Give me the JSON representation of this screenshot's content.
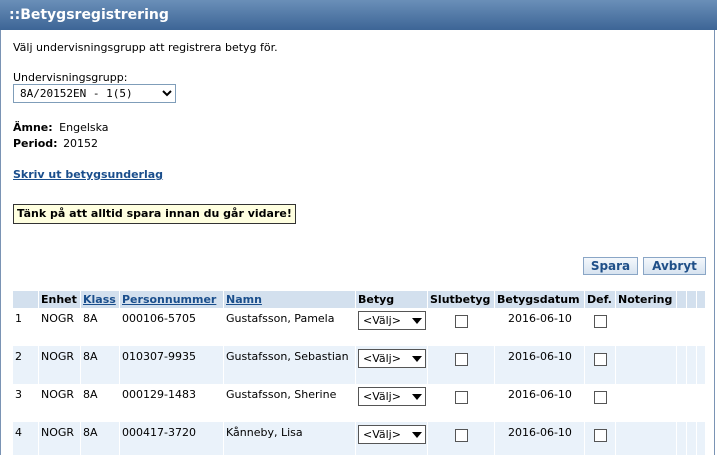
{
  "header": {
    "title": "::Betygsregistrering"
  },
  "intro": "Välj undervisningsgrupp att registrera betyg för.",
  "group": {
    "label": "Undervisningsgrupp:",
    "selected": "8A/20152EN - 1(5)"
  },
  "subject": {
    "label": "Ämne:",
    "value": "Engelska"
  },
  "period": {
    "label": "Period:",
    "value": "20152"
  },
  "print_link": "Skriv ut betygsunderlag",
  "warning": "Tänk på att alltid spara innan du går vidare!",
  "buttons": {
    "save": "Spara",
    "cancel": "Avbryt"
  },
  "table": {
    "headers": {
      "enhet": "Enhet",
      "klass": "Klass",
      "personnummer": "Personnummer",
      "namn": "Namn",
      "betyg": "Betyg",
      "slutbetyg": "Slutbetyg",
      "betygsdatum": "Betygsdatum",
      "def": "Def.",
      "notering": "Notering"
    },
    "rows": [
      {
        "nr": "1",
        "enhet": "NOGR",
        "klass": "8A",
        "pnr": "000106-5705",
        "namn": "Gustafsson, Pamela",
        "betyg": "<Välj>",
        "datum": "2016-06-10"
      },
      {
        "nr": "2",
        "enhet": "NOGR",
        "klass": "8A",
        "pnr": "010307-9935",
        "namn": "Gustafsson, Sebastian",
        "betyg": "<Välj>",
        "datum": "2016-06-10"
      },
      {
        "nr": "3",
        "enhet": "NOGR",
        "klass": "8A",
        "pnr": "000129-1483",
        "namn": "Gustafsson, Sherine",
        "betyg": "<Välj>",
        "datum": "2016-06-10"
      },
      {
        "nr": "4",
        "enhet": "NOGR",
        "klass": "8A",
        "pnr": "000417-3720",
        "namn": "Kånneby, Lisa",
        "betyg": "<Välj>",
        "datum": "2016-06-10"
      }
    ]
  }
}
